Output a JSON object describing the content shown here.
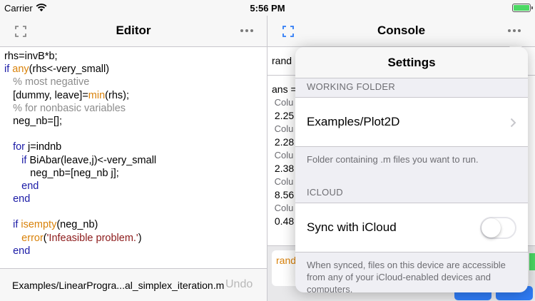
{
  "status_bar": {
    "carrier": "Carrier",
    "time": "5:56 PM",
    "battery_color": "#4cd964"
  },
  "editor": {
    "title": "Editor",
    "code_lines": [
      [
        {
          "t": "rhs=invB*b;",
          "c": "plain"
        }
      ],
      [
        {
          "t": "if",
          "c": "kw"
        },
        {
          "t": " ",
          "c": "plain"
        },
        {
          "t": "any",
          "c": "fn"
        },
        {
          "t": "(rhs<-very_small)",
          "c": "plain"
        }
      ],
      [
        {
          "t": "   % most negative",
          "c": "cm"
        }
      ],
      [
        {
          "t": "   [dummy, leave]=",
          "c": "plain"
        },
        {
          "t": "min",
          "c": "fn"
        },
        {
          "t": "(rhs);",
          "c": "plain"
        }
      ],
      [
        {
          "t": "   % for nonbasic variables",
          "c": "cm"
        }
      ],
      [
        {
          "t": "   neg_nb=[];",
          "c": "plain"
        }
      ],
      [
        {
          "t": "",
          "c": "plain"
        }
      ],
      [
        {
          "t": "   ",
          "c": "plain"
        },
        {
          "t": "for",
          "c": "kw"
        },
        {
          "t": " j=indnb",
          "c": "plain"
        }
      ],
      [
        {
          "t": "      ",
          "c": "plain"
        },
        {
          "t": "if",
          "c": "kw"
        },
        {
          "t": " BiAbar(leave,j)<-very_small",
          "c": "plain"
        }
      ],
      [
        {
          "t": "         neg_nb=[neg_nb j];",
          "c": "plain"
        }
      ],
      [
        {
          "t": "      ",
          "c": "plain"
        },
        {
          "t": "end",
          "c": "kw"
        }
      ],
      [
        {
          "t": "   ",
          "c": "plain"
        },
        {
          "t": "end",
          "c": "kw"
        }
      ],
      [
        {
          "t": "",
          "c": "plain"
        }
      ],
      [
        {
          "t": "   ",
          "c": "plain"
        },
        {
          "t": "if",
          "c": "kw"
        },
        {
          "t": " ",
          "c": "plain"
        },
        {
          "t": "isempty",
          "c": "fn"
        },
        {
          "t": "(neg_nb)",
          "c": "plain"
        }
      ],
      [
        {
          "t": "      ",
          "c": "plain"
        },
        {
          "t": "error",
          "c": "fn"
        },
        {
          "t": "(",
          "c": "plain"
        },
        {
          "t": "'Infeasible problem.'",
          "c": "str"
        },
        {
          "t": ")",
          "c": "plain"
        }
      ],
      [
        {
          "t": "   ",
          "c": "plain"
        },
        {
          "t": "end",
          "c": "kw"
        }
      ]
    ],
    "filename": "Examples/LinearProgra...al_simplex_iteration.m",
    "undo_label": "Undo",
    "colors": {
      "keyword": "#1a1aa6",
      "function": "#d9820a",
      "comment": "#8c8c8c",
      "string": "#8c1a1a"
    }
  },
  "console": {
    "title": "Console",
    "rand_line": "rand",
    "output_lines": [
      {
        "t": "ans =",
        "c": "plain"
      },
      {
        "t": " Colu",
        "c": "dim"
      },
      {
        "t": " 2.25",
        "c": "plain"
      },
      {
        "t": " Colu",
        "c": "dim"
      },
      {
        "t": " 2.28",
        "c": "plain"
      },
      {
        "t": " Colu",
        "c": "dim"
      },
      {
        "t": " 2.38",
        "c": "plain"
      },
      {
        "t": " Colu",
        "c": "dim"
      },
      {
        "t": " 8.56",
        "c": "plain"
      },
      {
        "t": " Colu",
        "c": "dim"
      },
      {
        "t": " 0.48",
        "c": "plain"
      }
    ],
    "input_text": "rand",
    "accent": "#2f7cf6"
  },
  "settings": {
    "title": "Settings",
    "working_folder_header": "WORKING FOLDER",
    "folder_value": "Examples/Plot2D",
    "folder_footer": "Folder containing .m files you want to run.",
    "icloud_header": "ICLOUD",
    "sync_label": "Sync with iCloud",
    "sync_enabled": false,
    "sync_footer": "When synced, files on this device are accessible from any of your iCloud-enabled devices and computers."
  }
}
